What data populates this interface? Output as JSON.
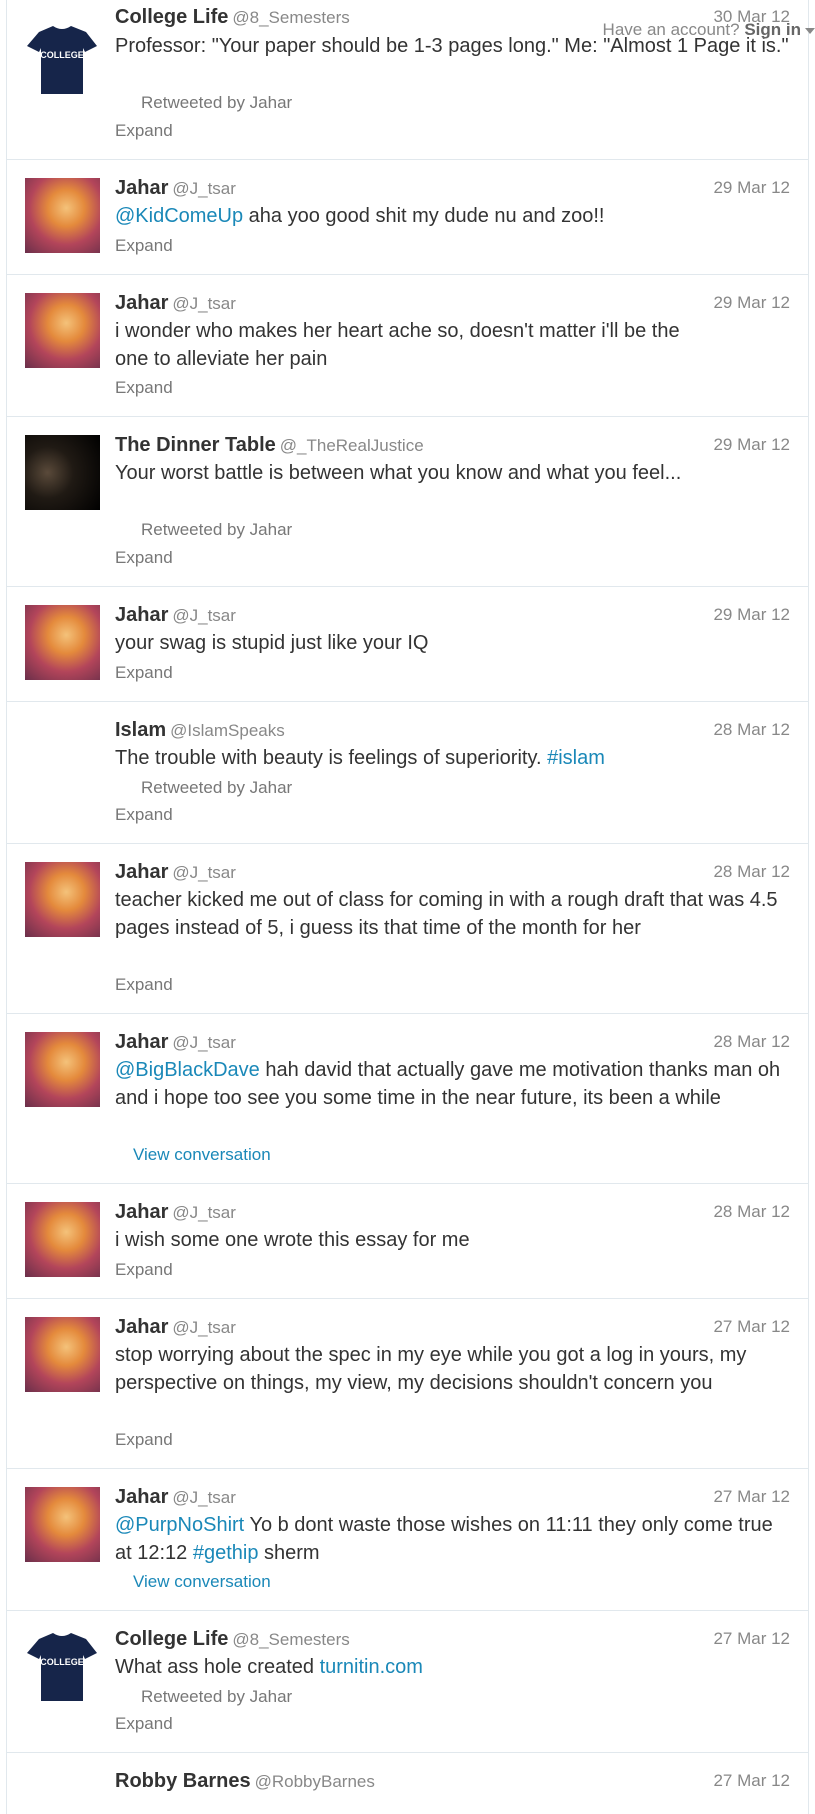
{
  "topbar": {
    "have_account": "Have an account?",
    "sign_in": "Sign in"
  },
  "tweets": [
    {
      "fullname": "College Life",
      "username": "@8_Semesters",
      "time": "30 Mar 12",
      "text_parts": [
        "Professor: \"Your paper should be 1-3 pages long.\" Me: \"Almost 1 Page it is.\""
      ],
      "retweeted_by": "Retweeted by Jahar",
      "action": "Expand"
    },
    {
      "fullname": "Jahar",
      "username": "@J_tsar",
      "time": "29 Mar 12",
      "mention": "@KidComeUp",
      "text": " aha yoo good shit my dude nu and zoo!!",
      "action": "Expand"
    },
    {
      "fullname": "Jahar",
      "username": "@J_tsar",
      "time": "29 Mar 12",
      "text": "i wonder who makes her heart ache so, doesn't matter i'll be the one to alleviate her pain",
      "action": "Expand"
    },
    {
      "fullname": "The Dinner Table",
      "username": "@_TheRealJustice",
      "time": "29 Mar 12",
      "text": "Your worst battle is between what you know and what you feel...",
      "retweeted_by": "Retweeted by Jahar",
      "action": "Expand"
    },
    {
      "fullname": "Jahar",
      "username": "@J_tsar",
      "time": "29 Mar 12",
      "text": "your swag is stupid just like your IQ",
      "action": "Expand"
    },
    {
      "fullname": "Islam",
      "username": "@IslamSpeaks",
      "time": "28 Mar 12",
      "text": "The trouble with beauty is feelings of superiority. ",
      "hashtag": "#islam",
      "retweeted_by": "Retweeted by Jahar",
      "action": "Expand"
    },
    {
      "fullname": "Jahar",
      "username": "@J_tsar",
      "time": "28 Mar 12",
      "text": "teacher kicked me out of class for coming in with a rough draft that was 4.5 pages instead of 5, i guess its that time of the month for her",
      "action": "Expand"
    },
    {
      "fullname": "Jahar",
      "username": "@J_tsar",
      "time": "28 Mar 12",
      "mention": "@BigBlackDave",
      "text": " hah david that actually gave me motivation thanks man oh and i hope too see you some time in the near future, its been a while",
      "action": "View conversation"
    },
    {
      "fullname": "Jahar",
      "username": "@J_tsar",
      "time": "28 Mar 12",
      "text": "i wish some one wrote this essay for me",
      "action": "Expand"
    },
    {
      "fullname": "Jahar",
      "username": "@J_tsar",
      "time": "27 Mar 12",
      "text": "stop worrying about the spec in my eye while you got a log in yours, my perspective on things, my view, my decisions shouldn't concern you",
      "action": "Expand"
    },
    {
      "fullname": "Jahar",
      "username": "@J_tsar",
      "time": "27 Mar 12",
      "mention": "@PurpNoShirt",
      "text": " Yo b dont waste those wishes on 11:11 they only come true at 12:12 ",
      "hashtag": "#gethip",
      "text_after": " sherm",
      "action": "View conversation"
    },
    {
      "fullname": "College Life",
      "username": "@8_Semesters",
      "time": "27 Mar 12",
      "text": "What ass hole created ",
      "link": "turnitin.com",
      "retweeted_by": "Retweeted by Jahar",
      "action": "Expand"
    },
    {
      "fullname": "Robby Barnes",
      "username": "@RobbyBarnes",
      "time": "27 Mar 12"
    }
  ],
  "avatar_labels": {
    "college_shirt": "COLLEGE"
  }
}
